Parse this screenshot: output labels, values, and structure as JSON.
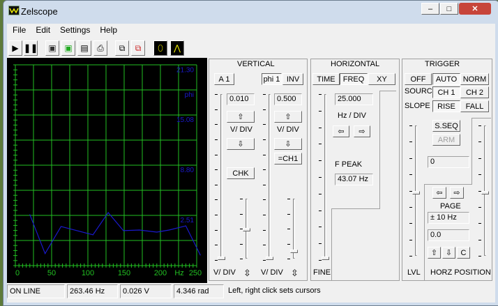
{
  "window": {
    "title": "Zelscope"
  },
  "menu": [
    "File",
    "Edit",
    "Settings",
    "Help"
  ],
  "toolbar": [
    "play",
    "pause",
    "save",
    "save-trace",
    "save-settings",
    "print",
    "copy",
    "copy-trace",
    "xy-mode",
    "spectrum-mode"
  ],
  "scope": {
    "y_labels": [
      "21.30",
      "phi",
      "15.08",
      "8.80",
      "2.51"
    ],
    "x_labels": [
      "0",
      "50",
      "100",
      "150",
      "200",
      "Hz",
      "250"
    ],
    "colors": {
      "grid": "#22c022",
      "trace": "#1a1acc",
      "label": "#1a1acc",
      "axis": "#22c022"
    }
  },
  "chart_data": {
    "type": "line",
    "xlabel": "Hz",
    "ylabel": "phi",
    "xlim": [
      0,
      250
    ],
    "ylim": [
      -3.77,
      21.35
    ],
    "y_ticks": [
      21.3,
      15.08,
      8.8,
      2.51
    ],
    "x_ticks": [
      0,
      50,
      100,
      150,
      200,
      250
    ],
    "grid": true,
    "series": [
      {
        "name": "phi 1",
        "x": [
          20,
          41,
          63,
          107,
          128,
          149,
          171,
          195,
          212,
          235,
          255
        ],
        "y": [
          2.6,
          -2.27,
          1.12,
          0.08,
          2.86,
          0.6,
          0.68,
          0.42,
          0.68,
          1.2,
          -2.45
        ]
      }
    ]
  },
  "vertical": {
    "title": "VERTICAL",
    "ch1_label": "A 1",
    "ch2_label": "phi 1",
    "inv": "INV",
    "ch1_vdiv": "0.010",
    "ch2_vdiv": "0.500",
    "vdiv": "V/ DIV",
    "up": "⇧",
    "down": "⇩",
    "eq_ch1": "=CH1",
    "chk": "CHK",
    "updown": "⇳"
  },
  "horizontal": {
    "title": "HORIZONTAL",
    "tabs": [
      "TIME",
      "FREQ",
      "XY"
    ],
    "active": "FREQ",
    "value": "25.000",
    "unit_label": "Hz / DIV",
    "left": "⇦",
    "right": "⇨",
    "fpeak_label": "F PEAK",
    "fpeak": "43.07 Hz",
    "fine": "FINE"
  },
  "trigger": {
    "title": "TRIGGER",
    "modes": [
      "OFF",
      "AUTO",
      "NORM"
    ],
    "source_label": "SOURCE",
    "sources": [
      "CH 1",
      "CH 2"
    ],
    "slope_label": "SLOPE",
    "slopes": [
      "RISE",
      "FALL"
    ],
    "sseq": "S.SEQ",
    "arm": "ARM",
    "level": "0",
    "page_label": "PAGE",
    "page": "± 10 Hz",
    "position": "0.0",
    "up": "⇧",
    "down": "⇩",
    "c": "C",
    "left": "⇦",
    "right": "⇨",
    "lvl": "LVL",
    "horz_position": "HORZ POSITION"
  },
  "status": {
    "state": "ON LINE",
    "freq": "263.46 Hz",
    "volt": "0.026 V",
    "phase": "4.346 rad",
    "message": "Left, right click sets cursors"
  }
}
